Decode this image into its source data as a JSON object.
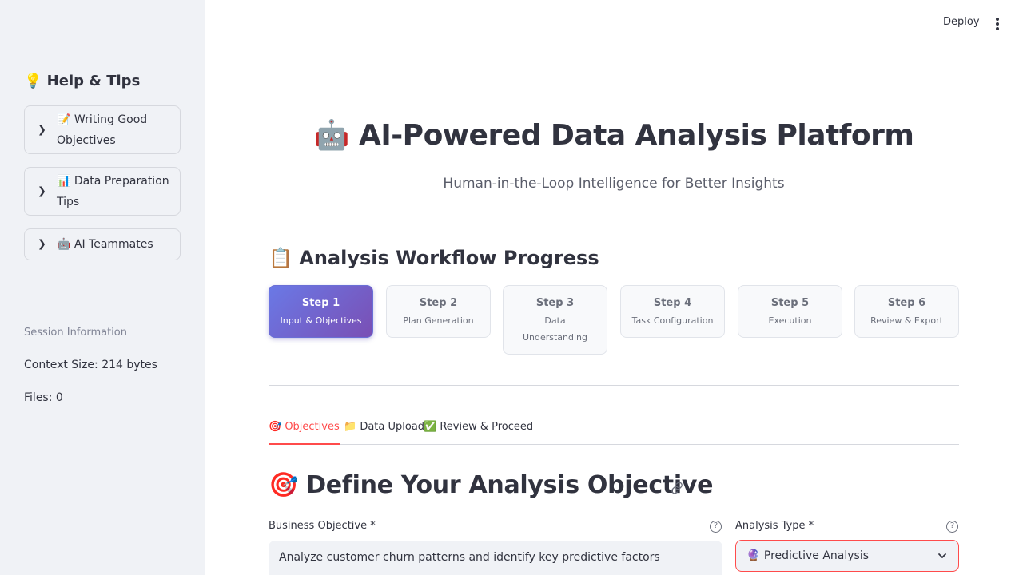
{
  "sidebar": {
    "heading": "💡 Help & Tips",
    "expanders": [
      {
        "label": "📝 Writing Good Objectives"
      },
      {
        "label": "📊 Data Preparation Tips"
      },
      {
        "label": "🤖 AI Teammates"
      }
    ],
    "session_caption": "Session Information",
    "context_size": "Context Size: 214 bytes",
    "files": "Files: 0"
  },
  "header": {
    "deploy_label": "Deploy"
  },
  "main": {
    "title": "🤖 AI-Powered Data Analysis Platform",
    "subtitle": "Human-in-the-Loop Intelligence for Better Insights",
    "workflow_heading": "📋 Analysis Workflow Progress",
    "steps": [
      {
        "num": "Step 1",
        "label": "Input & Objectives",
        "active": true
      },
      {
        "num": "Step 2",
        "label": "Plan Generation",
        "active": false
      },
      {
        "num": "Step 3",
        "label": "Data Understanding",
        "active": false
      },
      {
        "num": "Step 4",
        "label": "Task Configuration",
        "active": false
      },
      {
        "num": "Step 5",
        "label": "Execution",
        "active": false
      },
      {
        "num": "Step 6",
        "label": "Review & Export",
        "active": false
      }
    ],
    "tabs": [
      {
        "label": "🎯 Objectives",
        "active": true
      },
      {
        "label": "📁 Data Upload",
        "active": false
      },
      {
        "label": "✅ Review & Proceed",
        "active": false
      }
    ],
    "objective_heading": "🎯 Define Your Analysis Objective",
    "business_objective": {
      "label": "Business Objective *",
      "value": "Analyze customer churn patterns and identify key predictive factors"
    },
    "analysis_type": {
      "label": "Analysis Type *",
      "value": "🔮 Predictive Analysis"
    }
  },
  "colors": {
    "accent": "#ff4b4b",
    "sidebar_bg": "#f0f2f6",
    "step_active_start": "#6a79e6",
    "step_active_end": "#7a4fb4"
  }
}
